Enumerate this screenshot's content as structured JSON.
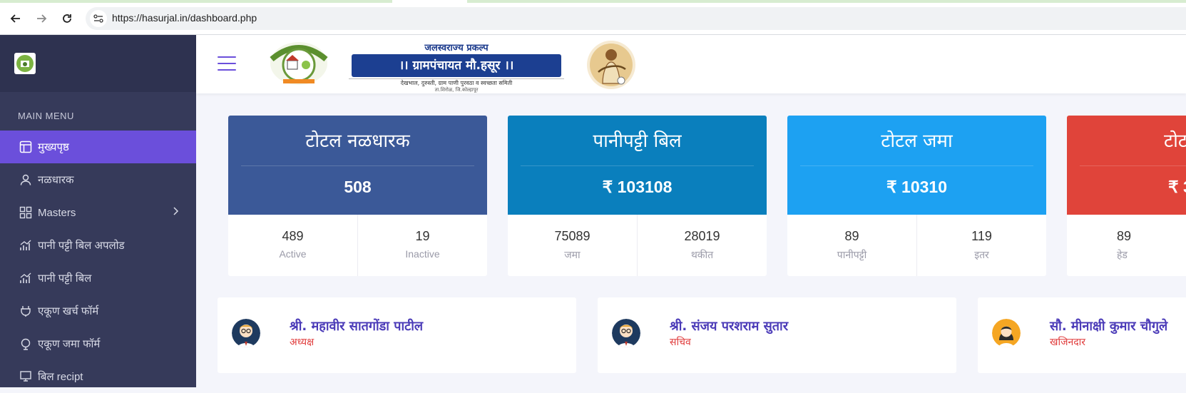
{
  "browser": {
    "url": "https://hasurjal.in/dashboard.php"
  },
  "sidebar": {
    "section_title": "MAIN MENU",
    "items": [
      {
        "label": "मुख्यपृष्ठ",
        "icon": "layout-icon",
        "active": true
      },
      {
        "label": "नळधारक",
        "icon": "user-icon"
      },
      {
        "label": "Masters",
        "icon": "grid-icon",
        "has_submenu": true
      },
      {
        "label": "पानी पट्टी बिल अपलोड",
        "icon": "chart-up-icon"
      },
      {
        "label": "पानी पट्टी बिल",
        "icon": "chart-bar-icon"
      },
      {
        "label": "एकूण खर्च फॉर्म",
        "icon": "plug-icon"
      },
      {
        "label": "एकूण जमा फॉर्म",
        "icon": "globe-icon"
      },
      {
        "label": "बिल recipt",
        "icon": "receipt-icon"
      }
    ]
  },
  "header": {
    "banner_top": "जलस्वराज्य प्रकल्प",
    "banner_main": "।। ग्रामपंचायत मौ.हसूर ।।",
    "banner_sub": "देखभाल, दुरुस्ती, ग्राम पाणी पुरवठा व स्वच्छता समिती",
    "banner_sub2": "ता.शिरोळ, जि.कोल्हापूर"
  },
  "cards": [
    {
      "title": "टोटल नळधारक",
      "value": "508",
      "color": "#3b5998",
      "stats": [
        {
          "num": "489",
          "label": "Active"
        },
        {
          "num": "19",
          "label": "Inactive"
        }
      ]
    },
    {
      "title": "पानीपट्टी बिल",
      "value": "₹ 103108",
      "color": "#0a7fbd",
      "stats": [
        {
          "num": "75089",
          "label": "जमा"
        },
        {
          "num": "28019",
          "label": "थकीत"
        }
      ]
    },
    {
      "title": "टोटल जमा",
      "value": "₹ 10310",
      "color": "#1da1f2",
      "stats": [
        {
          "num": "89",
          "label": "पानीपट्टी"
        },
        {
          "num": "119",
          "label": "इतर"
        }
      ]
    },
    {
      "title": "टोट",
      "value": "₹ 3",
      "color": "#e0443a",
      "stats": [
        {
          "num": "89",
          "label": "हेड"
        },
        {
          "num": "",
          "label": ""
        }
      ]
    }
  ],
  "people": [
    {
      "name": "श्री. महावीर सातगोंडा पाटील",
      "role": "अध्यक्ष",
      "avatar": "male-avatar-icon"
    },
    {
      "name": "श्री. संजय परशराम सुतार",
      "role": "सचिव",
      "avatar": "male-avatar-icon"
    },
    {
      "name": "सौ. मीनाक्षी कुमार चौगुले",
      "role": "खजिनदार",
      "avatar": "female-avatar-icon"
    }
  ]
}
